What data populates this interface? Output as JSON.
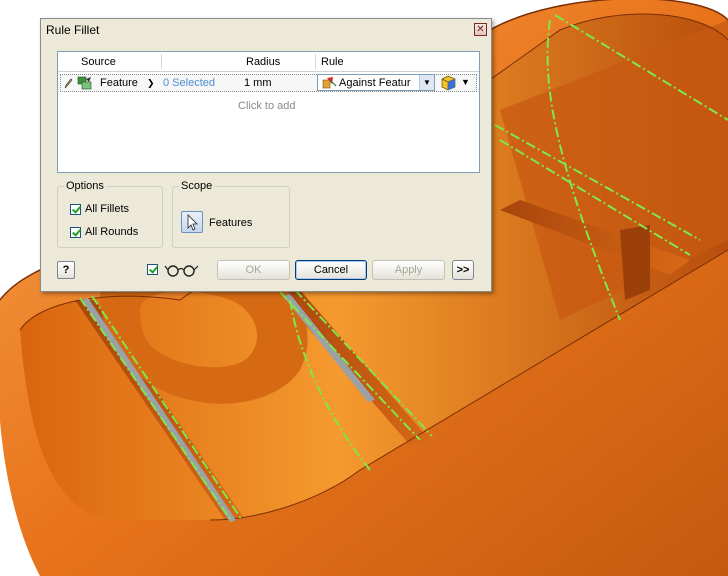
{
  "dialog": {
    "title": "Rule Fillet",
    "close_glyph": "✕",
    "grid": {
      "columns": [
        "Source",
        "Radius",
        "Rule"
      ],
      "row": {
        "source": "Feature",
        "selected": "0 Selected",
        "radius": "1 mm",
        "rule": "Against Featur"
      },
      "add_hint": "Click to add"
    },
    "options": {
      "label": "Options",
      "all_fillets": {
        "label": "All Fillets",
        "checked": true
      },
      "all_rounds": {
        "label": "All Rounds",
        "checked": true
      }
    },
    "scope": {
      "label": "Scope",
      "button_label": "Features"
    },
    "buttons": {
      "help": "?",
      "ok": "OK",
      "cancel": "Cancel",
      "apply": "Apply",
      "more": ">>"
    }
  },
  "colors": {
    "model_orange": "#e8741c",
    "model_edge_green": "#7ee84a",
    "dialog_bg": "#ece9d8"
  }
}
